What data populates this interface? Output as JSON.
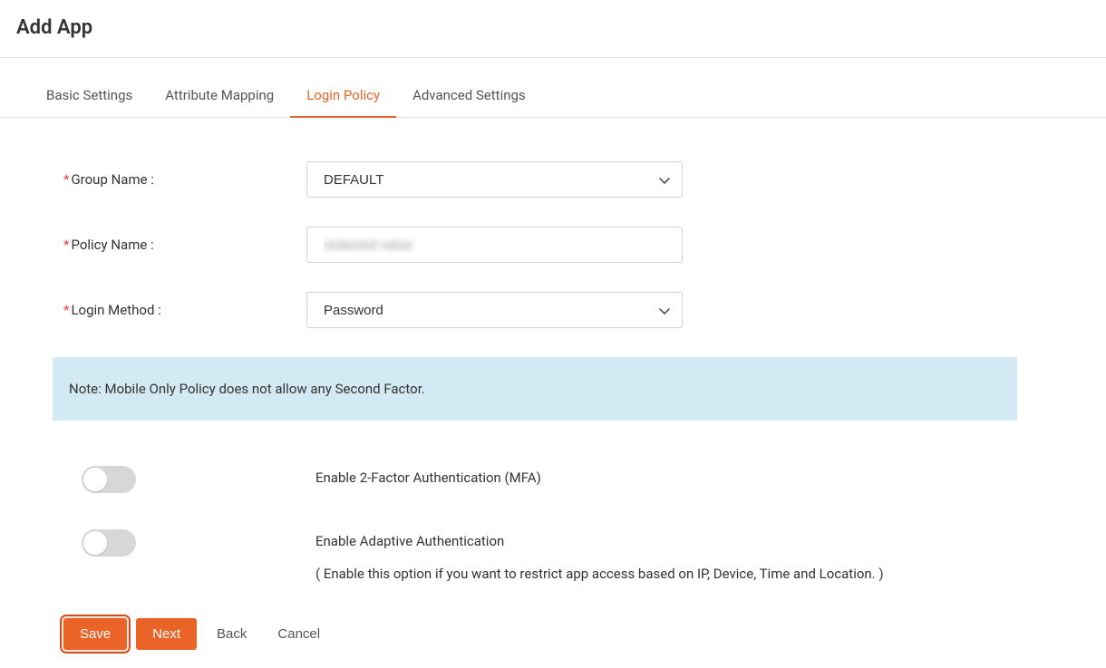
{
  "header": {
    "title": "Add App"
  },
  "tabs": [
    {
      "label": "Basic Settings",
      "active": false
    },
    {
      "label": "Attribute Mapping",
      "active": false
    },
    {
      "label": "Login Policy",
      "active": true
    },
    {
      "label": "Advanced Settings",
      "active": false
    }
  ],
  "form": {
    "groupName": {
      "label": "Group Name :",
      "value": "DEFAULT"
    },
    "policyName": {
      "label": "Policy Name :",
      "value": "redacted value"
    },
    "loginMethod": {
      "label": "Login Method :",
      "value": "Password"
    }
  },
  "note": "Note: Mobile Only Policy does not allow any Second Factor.",
  "toggles": {
    "mfa": {
      "label": "Enable 2-Factor Authentication (MFA)",
      "enabled": false
    },
    "adaptive": {
      "label": "Enable Adaptive Authentication",
      "subtext": "( Enable this option if you want to restrict app access based on IP, Device, Time and Location. )",
      "enabled": false
    }
  },
  "buttons": {
    "save": "Save",
    "next": "Next",
    "back": "Back",
    "cancel": "Cancel"
  }
}
